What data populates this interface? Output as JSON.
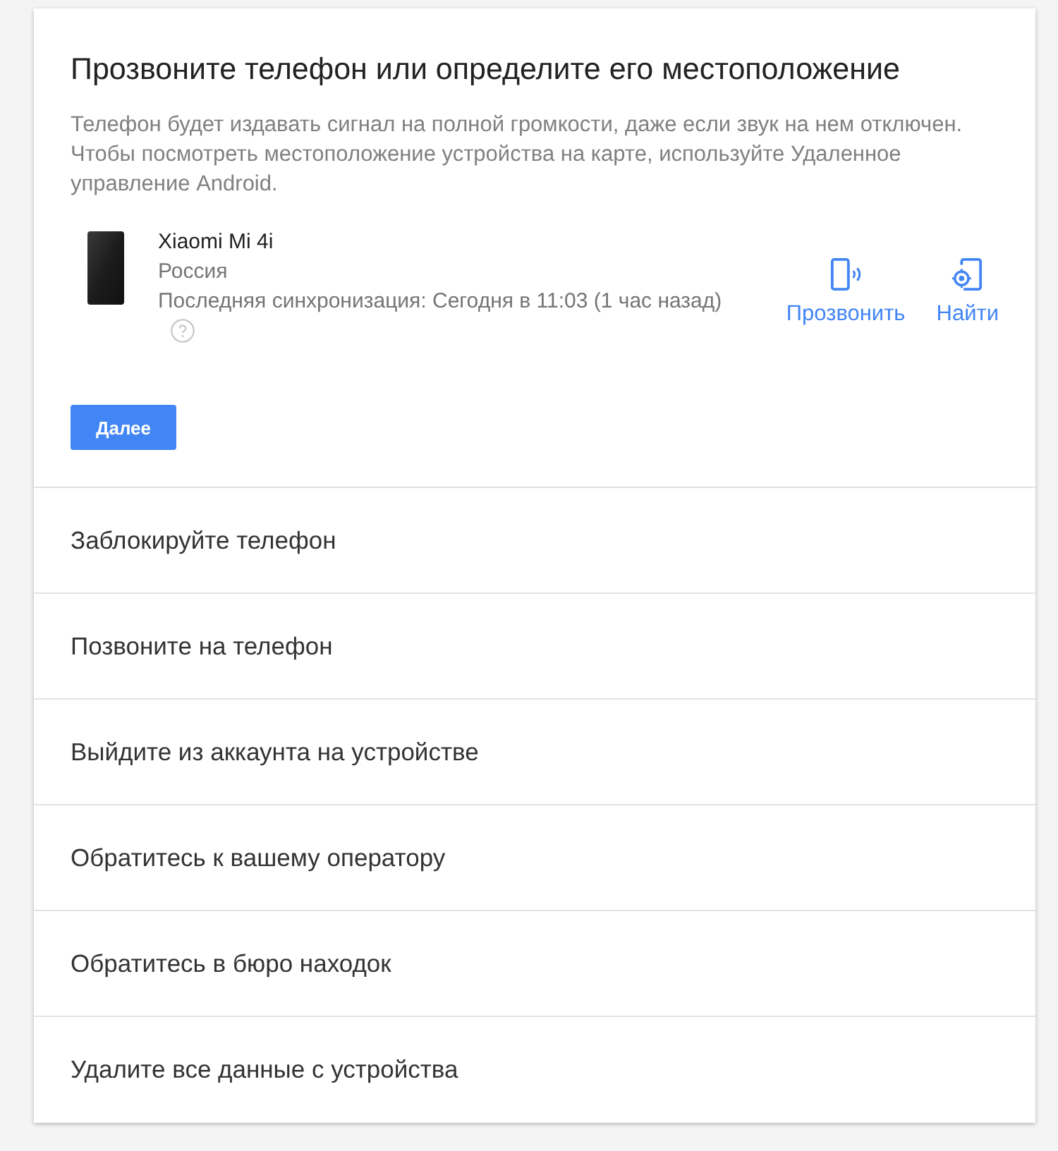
{
  "header": {
    "title": "Прозвоните телефон или определите его местоположение",
    "description": "Телефон будет издавать сигнал на полной громкости, даже если звук на нем отключен. Чтобы посмотреть местоположение устройства на карте, используйте Удаленное управление Android."
  },
  "device": {
    "name": "Xiaomi Mi 4i",
    "country": "Россия",
    "last_sync": "Последняя синхронизация: Сегодня в 11:03 (1 час назад)"
  },
  "actions": [
    {
      "kind": "ring",
      "label": "Прозвонить"
    },
    {
      "kind": "locate",
      "label": "Найти"
    }
  ],
  "next_button": "Далее",
  "options": [
    "Заблокируйте телефон",
    "Позвоните на телефон",
    "Выйдите из аккаунта на устройстве",
    "Обратитесь к вашему оператору",
    "Обратитесь в бюро находок",
    "Удалите все данные с устройства"
  ]
}
